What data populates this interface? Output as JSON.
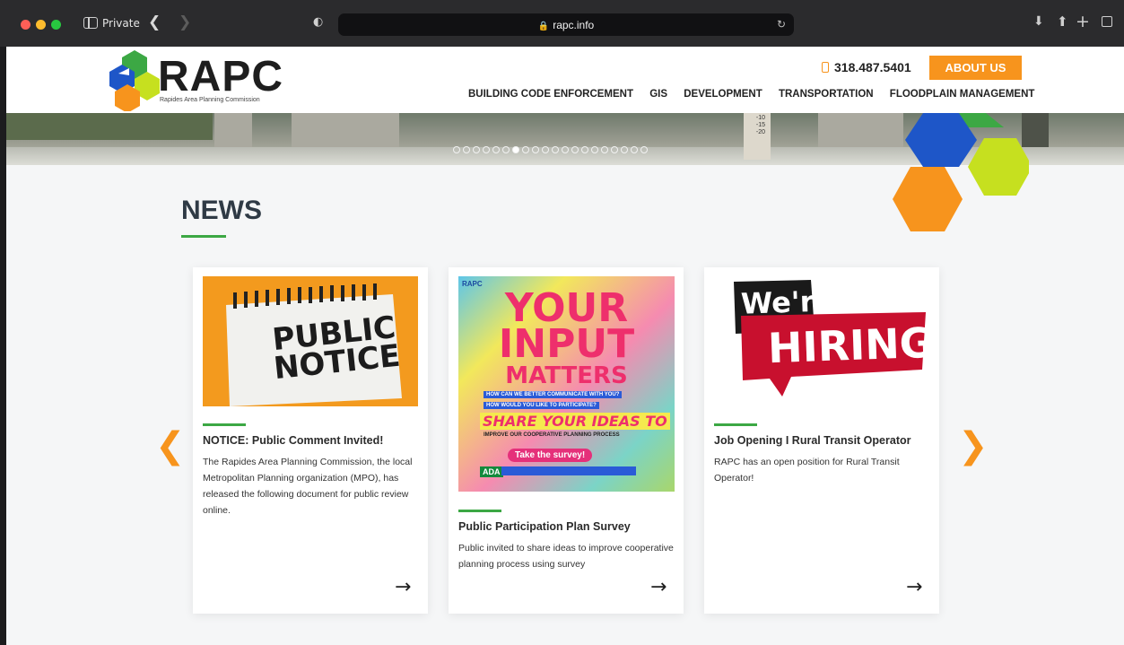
{
  "browser": {
    "private_label": "Private",
    "url": "rapc.info"
  },
  "header": {
    "logo_text": "RAPC",
    "logo_tagline": "Rapides Area Planning Commission",
    "phone": "318.487.5401",
    "about_button": "ABOUT US",
    "nav": [
      "BUILDING CODE ENFORCEMENT",
      "GIS",
      "DEVELOPMENT",
      "TRANSPORTATION",
      "FLOODPLAIN MANAGEMENT"
    ],
    "colors": {
      "orange": "#f7941d",
      "green": "#3ca844",
      "blue": "#1e56c8",
      "lime": "#c6e01f"
    }
  },
  "hero": {
    "gauge_labels": [
      "-10",
      "-15",
      "-20"
    ],
    "slide_count": 20,
    "active_slide": 6
  },
  "news": {
    "title": "NEWS",
    "cards": [
      {
        "image_label": "PUBLIC NOTICE",
        "title": "NOTICE: Public Comment Invited!",
        "text": "The Rapides Area Planning Commission, the local Metropolitan Planning organization (MPO), has released the following document for public review online."
      },
      {
        "image_label_1": "YOUR",
        "image_label_2": "INPUT",
        "image_label_3": "MATTERS",
        "image_line_1": "HOW CAN WE BETTER COMMUNICATE WITH YOU?",
        "image_line_2": "HOW WOULD YOU LIKE TO PARTICIPATE?",
        "image_line_3": "SHARE YOUR IDEAS TO",
        "image_line_4": "IMPROVE OUR COOPERATIVE PLANNING PROCESS",
        "image_button": "Take the survey!",
        "image_ada": "ADA",
        "title": "Public Participation Plan Survey",
        "text": "Public invited to share ideas to improve cooperative planning process using survey"
      },
      {
        "image_label_1": "We're",
        "image_label_2": "HIRING",
        "title": "Job Opening I Rural Transit Operator",
        "text": "RAPC has an open position for Rural Transit Operator!"
      }
    ]
  }
}
